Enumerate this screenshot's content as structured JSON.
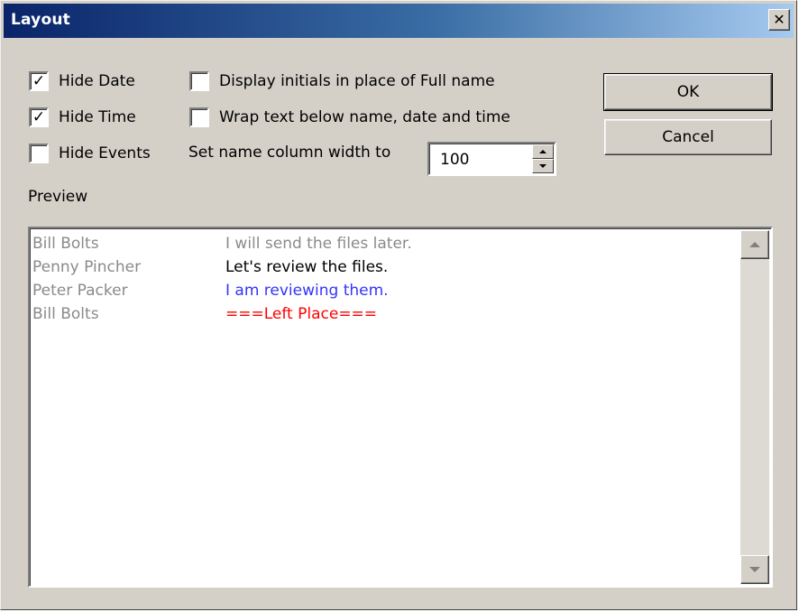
{
  "window": {
    "title": "Layout"
  },
  "options": {
    "hide_date": {
      "label": "Hide Date",
      "checked": true
    },
    "hide_time": {
      "label": "Hide Time",
      "checked": true
    },
    "hide_events": {
      "label": "Hide Events",
      "checked": false
    },
    "display_initials": {
      "label": "Display initials in place of Full name",
      "checked": false
    },
    "wrap_text": {
      "label": "Wrap text below name, date and time",
      "checked": false
    },
    "name_width": {
      "label": "Set name column width to",
      "value": "100"
    }
  },
  "buttons": {
    "ok": "OK",
    "cancel": "Cancel"
  },
  "preview": {
    "label": "Preview",
    "messages": [
      {
        "name": "Bill Bolts",
        "text": "I will send the files later.",
        "color": "#8a8a8a"
      },
      {
        "name": "Penny Pincher",
        "text": "Let's review the files.",
        "color": "#000000"
      },
      {
        "name": "Peter Packer",
        "text": "I am reviewing them.",
        "color": "#3333ff"
      },
      {
        "name": "Bill Bolts",
        "text": "===Left Place===",
        "color": "#ff0000"
      }
    ]
  }
}
